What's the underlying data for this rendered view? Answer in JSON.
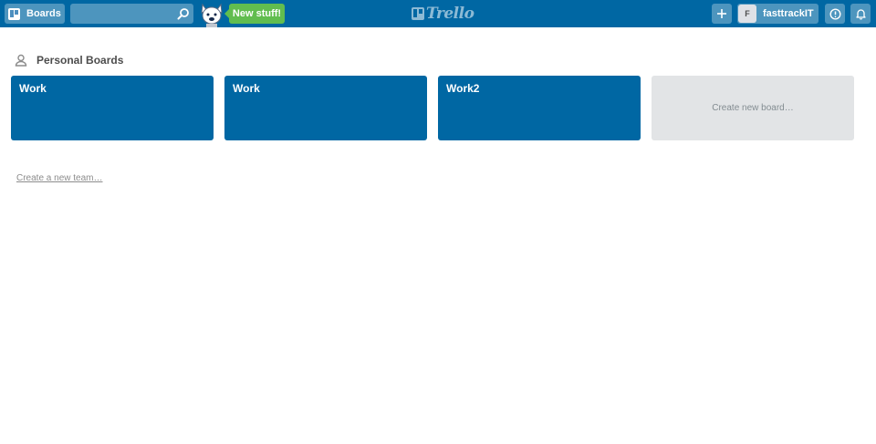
{
  "header": {
    "boards_label": "Boards",
    "search_placeholder": "",
    "new_stuff_label": "New stuff!",
    "logo_text": "Trello",
    "member_initial": "F",
    "member_name": "fasttrackIT"
  },
  "personal": {
    "title": "Personal Boards",
    "boards": [
      {
        "name": "Work"
      },
      {
        "name": "Work"
      },
      {
        "name": "Work2"
      }
    ],
    "create_board_label": "Create new board…"
  },
  "create_team_label": "Create a new team…",
  "colors": {
    "header": "#0067a3",
    "board": "#0067a3",
    "new_stuff": "#61bd4f",
    "create_board_bg": "#e2e4e6"
  },
  "icons": [
    "boards-icon",
    "search-icon",
    "mascot-icon",
    "trello-logo-icon",
    "plus-icon",
    "info-icon",
    "bell-icon",
    "person-icon"
  ]
}
